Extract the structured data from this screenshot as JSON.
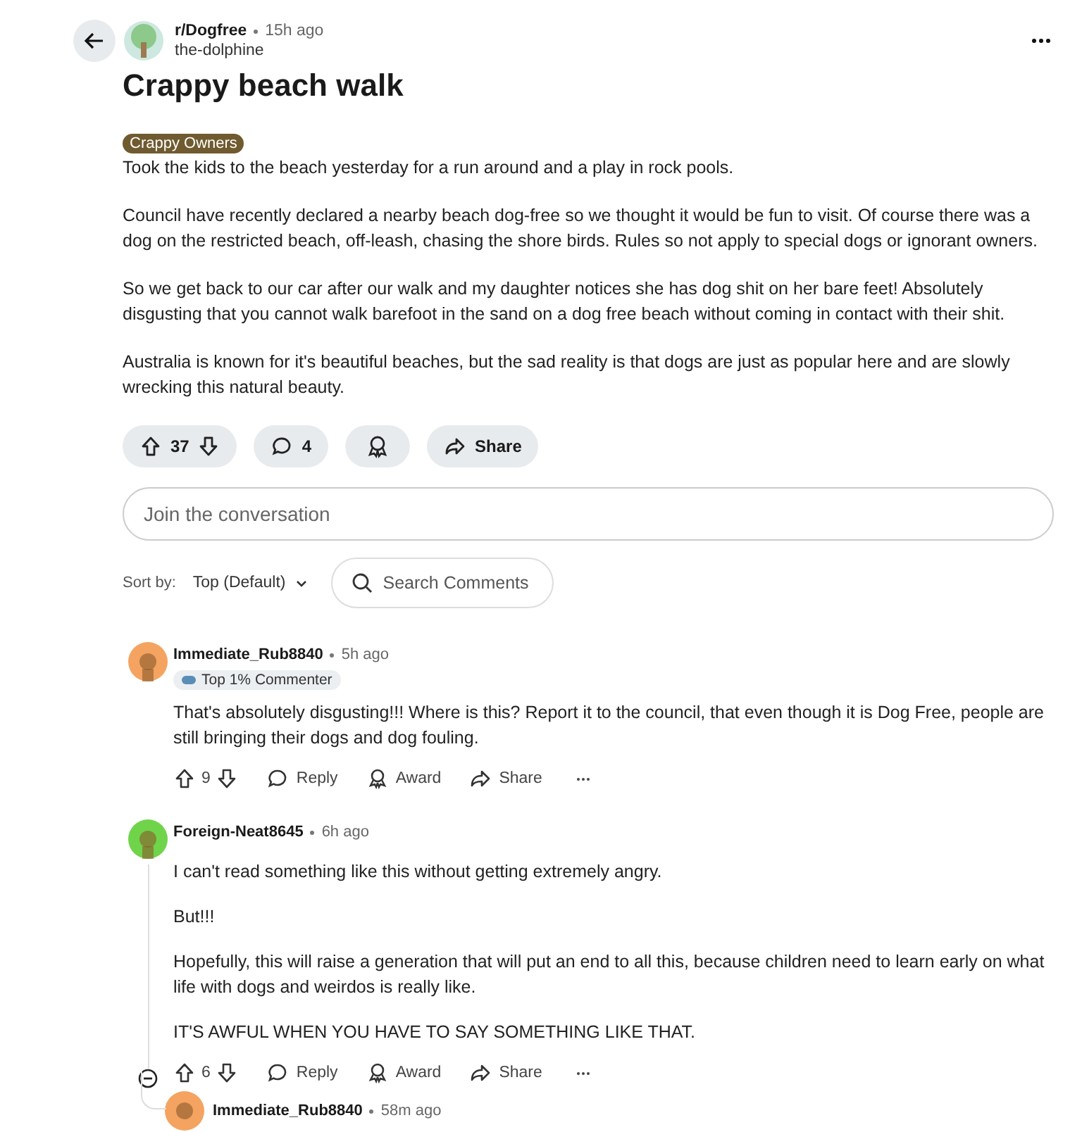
{
  "post": {
    "subreddit": "r/Dogfree",
    "time": "15h ago",
    "author": "the-dolphine",
    "title": "Crappy beach walk",
    "flair": "Crappy Owners",
    "paragraphs": [
      "Took the kids to the beach yesterday for a run around and a play in rock pools.",
      "Council have recently declared a nearby beach dog-free so we thought it would be fun to visit. Of course there was a dog on the restricted beach, off-leash, chasing the shore birds. Rules so not apply to special dogs or ignorant owners.",
      "So we get back to our car after our walk and my daughter notices she has dog shit on her bare feet! Absolutely disgusting that you cannot walk barefoot in the sand on a dog free beach without coming in contact with their shit.",
      "Australia is known for it's beautiful beaches, but the sad reality is that dogs are just as popular here and are slowly wrecking this natural beauty."
    ],
    "votes": "37",
    "comments": "4",
    "share": "Share"
  },
  "composer": {
    "placeholder": "Join the conversation"
  },
  "sort": {
    "label": "Sort by:",
    "value": "Top (Default)"
  },
  "search": {
    "placeholder": "Search Comments"
  },
  "comments": [
    {
      "author": "Immediate_Rub8840",
      "time": "5h ago",
      "color": "#f4a460",
      "flair": "Top 1% Commenter",
      "paragraphs": [
        "That's absolutely disgusting!!! Where is this? Report it to the council, that even though it is Dog Free, people are still bringing their dogs and dog fouling."
      ],
      "votes": "9",
      "reply": "Reply",
      "award": "Award",
      "share": "Share"
    },
    {
      "author": "Foreign-Neat8645",
      "time": "6h ago",
      "color": "#6fd44a",
      "paragraphs": [
        "I can't read something like this without getting extremely angry.",
        "But!!!",
        "Hopefully, this will raise a generation that will put an end to all this, because children need to learn early on what life with dogs and weirdos is really like.",
        "IT'S AWFUL WHEN YOU HAVE TO SAY SOMETHING LIKE THAT."
      ],
      "votes": "6",
      "reply": "Reply",
      "award": "Award",
      "share": "Share",
      "expanded": true,
      "children": [
        {
          "author": "Immediate_Rub8840",
          "time": "58m ago",
          "color": "#f4a460"
        }
      ]
    }
  ]
}
